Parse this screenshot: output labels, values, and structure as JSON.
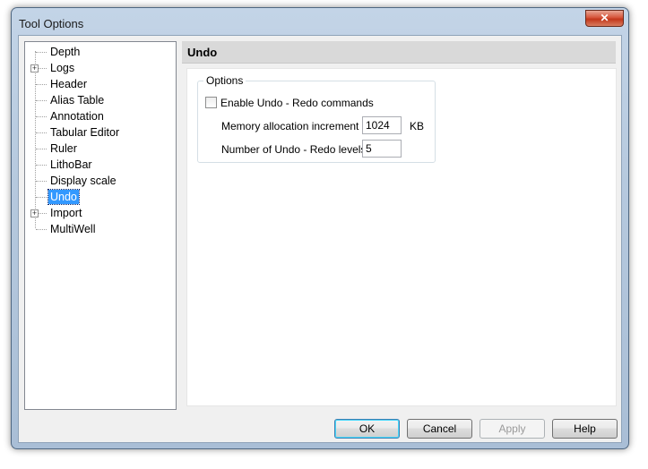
{
  "window": {
    "title": "Tool Options",
    "close_symbol": "✕"
  },
  "tree": {
    "items": [
      {
        "label": "Depth",
        "expandable": false
      },
      {
        "label": "Logs",
        "expandable": true
      },
      {
        "label": "Header",
        "expandable": false
      },
      {
        "label": "Alias Table",
        "expandable": false
      },
      {
        "label": "Annotation",
        "expandable": false
      },
      {
        "label": "Tabular Editor",
        "expandable": false
      },
      {
        "label": "Ruler",
        "expandable": false
      },
      {
        "label": "LithoBar",
        "expandable": false
      },
      {
        "label": "Display scale",
        "expandable": false
      },
      {
        "label": "Undo",
        "expandable": false,
        "selected": true
      },
      {
        "label": "Import",
        "expandable": true
      },
      {
        "label": "MultiWell",
        "expandable": false
      }
    ],
    "expander_symbol": "+"
  },
  "panel": {
    "title": "Undo",
    "group_label": "Options",
    "enable_undo_label": "Enable Undo - Redo commands",
    "enable_undo_checked": false,
    "memory_label": "Memory allocation increment",
    "memory_value": "1024",
    "memory_unit": "KB",
    "levels_label": "Number of Undo - Redo levels",
    "levels_value": "5"
  },
  "buttons": {
    "ok": "OK",
    "cancel": "Cancel",
    "apply": "Apply",
    "help": "Help"
  }
}
